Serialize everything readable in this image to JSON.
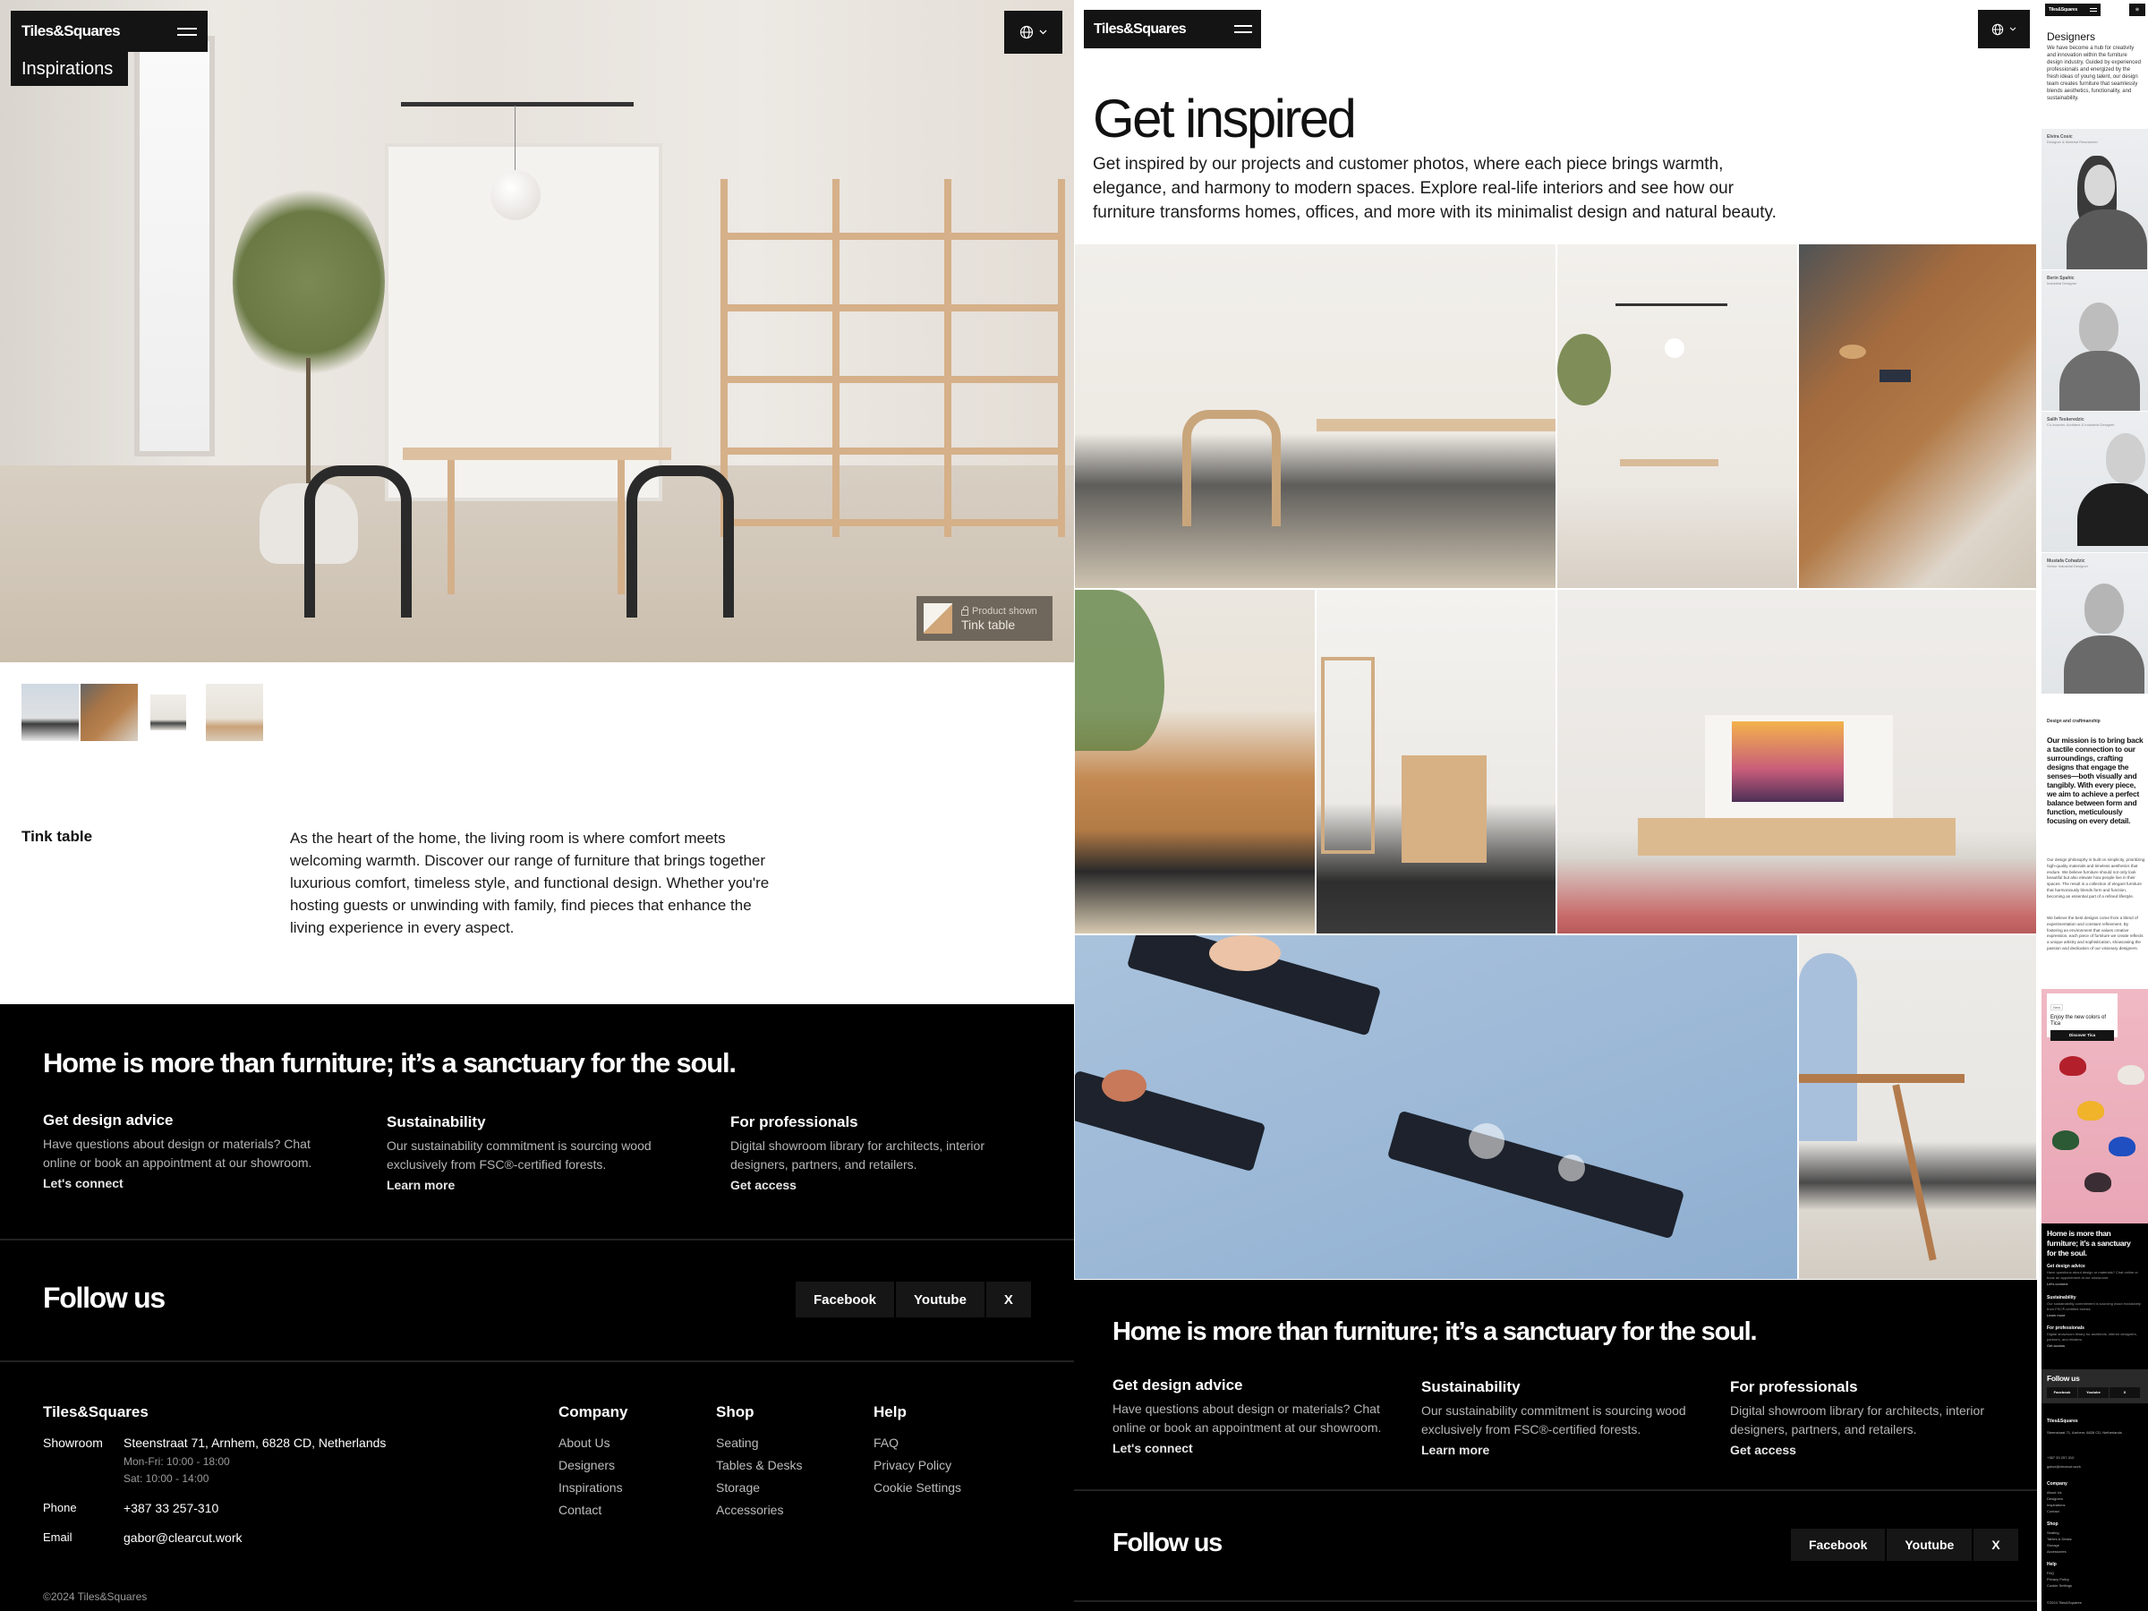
{
  "brand": "Tiles&Squares",
  "icons": {
    "menu": "hamburger-icon",
    "language": "globe-icon",
    "chevron": "chevron-down-icon",
    "lock": "lock-icon"
  },
  "colors": {
    "dark": "#141414",
    "footer_bg": "#000000",
    "muted_text": "#b5b5b5",
    "tag_bg": "#6f675c"
  },
  "detail": {
    "page_label": "Inspirations",
    "product_tag": {
      "kicker": "Product shown",
      "name": "Tink table"
    },
    "gallery_thumbnails": [
      "Tink table side view",
      "Walnut dining table top view",
      "Dining room with Tink table",
      "Oak table and chairs"
    ],
    "title": "Tink table",
    "description": "As the heart of the home, the living room is where comfort meets welcoming warmth. Discover our range of furniture that brings together luxurious comfort, timeless style, and functional design. Whether you're hosting guests or unwinding with family, find pieces that enhance the living experience in every aspect."
  },
  "inspirations": {
    "title": "Get inspired",
    "intro": "Get inspired by our projects and customer photos, where each piece brings warmth, elegance, and harmony to modern spaces. Explore real-life interiors and see how our furniture transforms homes, offices, and more with its minimalist design and natural beauty.",
    "gallery": [
      "Oak chair and dining table",
      "Dining room with pendant lamp",
      "Walnut table with woven chair",
      "Leather sofa in living room",
      "Shelf and oak cabinet",
      "Oak TV sideboard",
      "Black wall shelves on blue wall",
      "Walnut Tink table"
    ]
  },
  "designers": {
    "title": "Designers",
    "intro": "We have become a hub for creativity and innovation within the furniture design industry. Guided by experienced professionals and energized by the fresh ideas of young talent, our design team creates furniture that seamlessly blends aesthetics, functionality, and sustainability.",
    "people": [
      {
        "name": "Elvira Cosic",
        "role": "Designer & Material Researcher"
      },
      {
        "name": "Berin Spahic",
        "role": "Industrial Designer"
      },
      {
        "name": "Salih Teskeredzic",
        "role": "Co-founder, Architect & Industrial Designer"
      },
      {
        "name": "Mustafa Cohadzic",
        "role": "Senior Industrial Designer"
      }
    ],
    "kicker": "Design and craftmanship",
    "mission": "Our mission is to bring back a tactile connection to our surroundings, crafting designs that engage the senses—both visually and tangibly. With every piece, we aim to achieve a perfect balance between form and function, meticulously focusing on every detail.",
    "para1": "Our design philosophy is built on simplicity, prioritizing high-quality materials and timeless aesthetics that endure. We believe furniture should not only look beautiful but also elevate how people live in their spaces. The result is a collection of elegant furniture that harmoniously blends form and function, becoming an essential part of a refined lifestyle.",
    "para2": "We believe the best designs come from a blend of experimentation and constant refinement. By fostering an environment that values creative expression, each piece of furniture we create reflects a unique artistry and sophistication, showcasing the passion and dedication of our visionary designers.",
    "promo": {
      "badge": "New",
      "title": "Enjoy the new colors of Tica",
      "button": "Discover Tica"
    }
  },
  "footer": {
    "tagline": "Home is more than furniture; it’s a sanctuary for the soul.",
    "features": [
      {
        "title": "Get design advice",
        "text": "Have questions about design or materials? Chat online or book an appointment at our showroom.",
        "link": "Let's connect"
      },
      {
        "title": "Sustainability",
        "text": "Our sustainability commitment is sourcing wood exclusively from FSC®-certified forests.",
        "link": "Learn more"
      },
      {
        "title": "For professionals",
        "text": "Digital showroom library for architects, interior designers, partners, and retailers.",
        "link": "Get access"
      }
    ],
    "follow_title": "Follow us",
    "socials": [
      "Facebook",
      "Youtube",
      "X"
    ],
    "brand": "Tiles&Squares",
    "showroom_label": "Showroom",
    "address": "Steenstraat 71, Arnhem, 6828 CD, Netherlands",
    "hours_weekday": "Mon-Fri: 10:00 - 18:00",
    "hours_saturday": "Sat: 10:00 - 14:00",
    "phone_label": "Phone",
    "phone": "+387 33 257-310",
    "email_label": "Email",
    "email": "gabor@clearcut.work",
    "columns": [
      {
        "title": "Company",
        "links": [
          "About Us",
          "Designers",
          "Inspirations",
          "Contact"
        ]
      },
      {
        "title": "Shop",
        "links": [
          "Seating",
          "Tables & Desks",
          "Storage",
          "Accessories"
        ]
      },
      {
        "title": "Help",
        "links": [
          "FAQ",
          "Privacy Policy",
          "Cookie Settings"
        ]
      }
    ],
    "copyright": "©2024 Tiles&Squares"
  }
}
